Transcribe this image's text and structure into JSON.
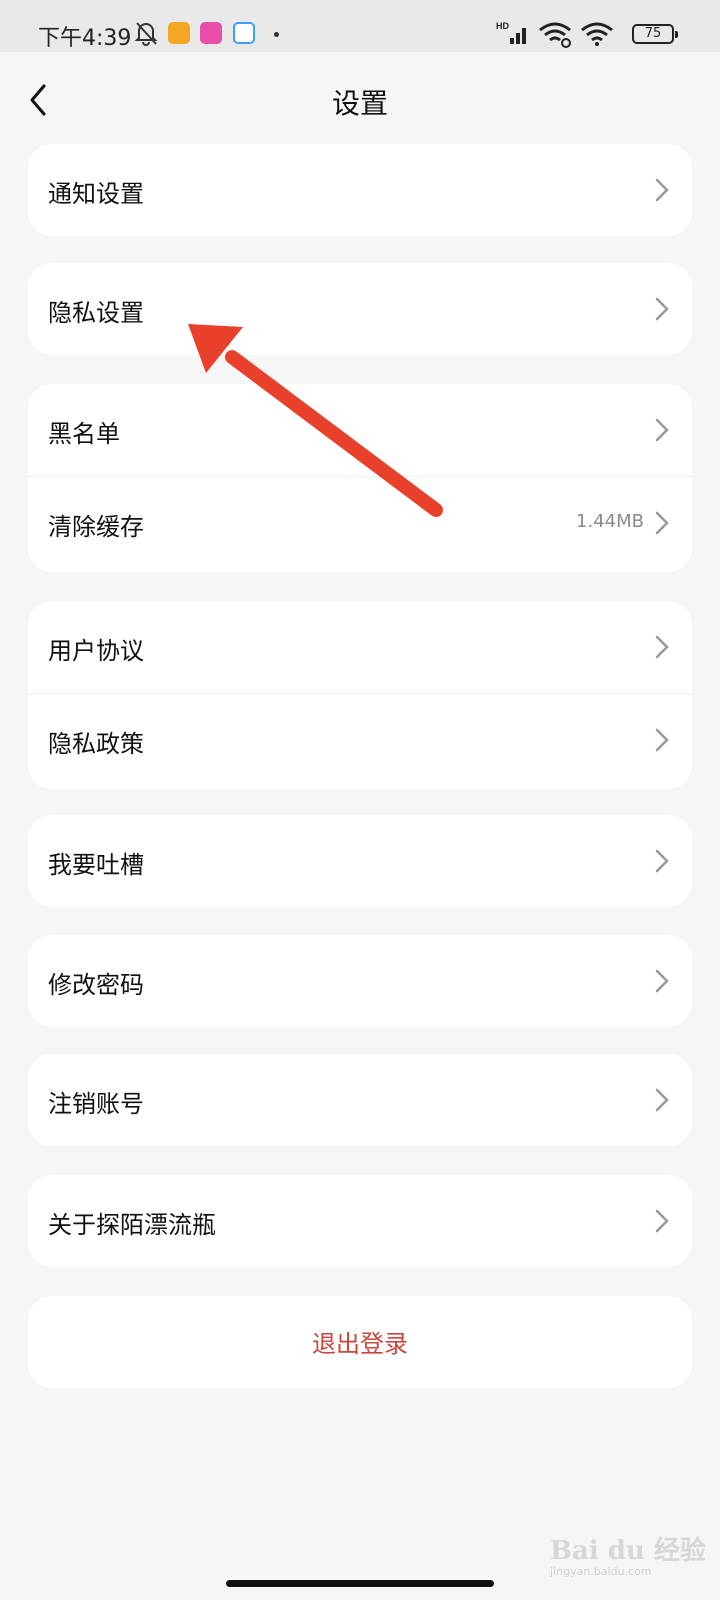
{
  "status_bar": {
    "time": "下午4:39",
    "battery": "75",
    "icons": [
      "bell-off-icon",
      "app-notification-icon",
      "app-notification-icon",
      "app-notification-icon",
      "hd-signal-icon",
      "wifi-icon",
      "wifi-icon",
      "battery-icon"
    ]
  },
  "header": {
    "title": "设置",
    "back_icon": "chevron-left-icon"
  },
  "settings": {
    "notifications": "通知设置",
    "privacy_settings": "隐私设置",
    "blacklist": "黑名单",
    "clear_cache": "清除缓存",
    "cache_size": "1.44MB",
    "user_agreement": "用户协议",
    "privacy_policy": "隐私政策",
    "feedback": "我要吐槽",
    "change_password": "修改密码",
    "delete_account": "注销账号",
    "about": "关于探陌漂流瓶",
    "logout": "退出登录"
  },
  "colors": {
    "logout_text": "#c9473d",
    "annotation_arrow": "#e8402a",
    "page_background": "#f6f6f6"
  },
  "watermark": {
    "brand": "Bai du 经验",
    "url": "jingyan.baidu.com"
  }
}
